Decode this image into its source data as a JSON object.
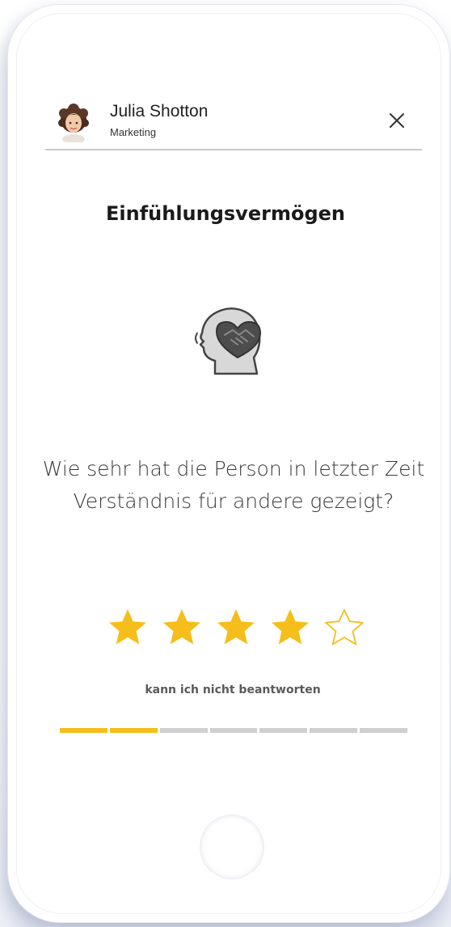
{
  "user": {
    "name": "Julia Shotton",
    "department": "Marketing"
  },
  "question": {
    "title": "Einfühlungsvermögen",
    "text": "Wie sehr hat die Person in letzter Zeit Verständnis für andere gezeigt?",
    "icon": "empathy-head-heart-icon"
  },
  "rating": {
    "value": 4,
    "max": 5
  },
  "cannot_answer_label": "kann ich nicht beantworten",
  "progress": {
    "completed": 2,
    "total": 7
  },
  "colors": {
    "accent": "#F5BE1A",
    "progress_empty": "#CFCFCF",
    "text_dark": "#1A1A1A"
  }
}
